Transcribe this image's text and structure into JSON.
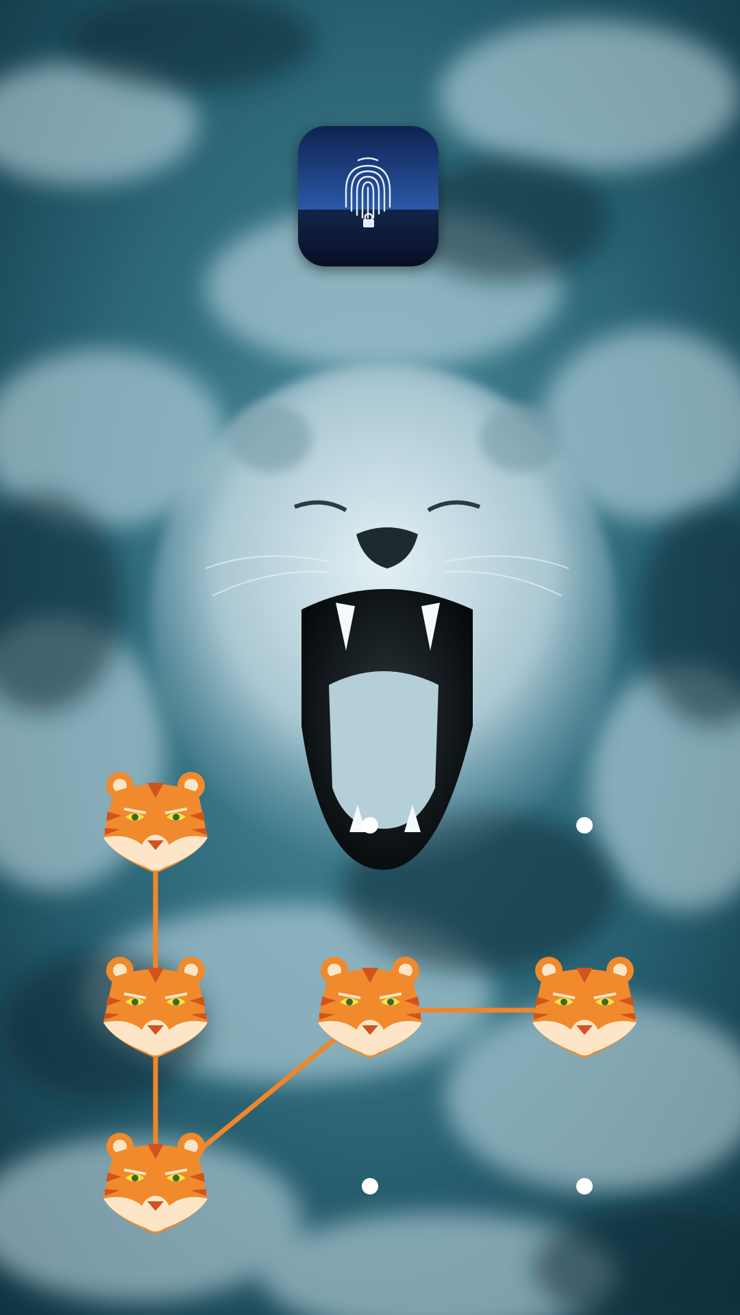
{
  "app": {
    "icon_name": "fingerprint-lock-icon",
    "colors": {
      "icon_top": "#1f3f7a",
      "icon_bottom": "#0d1a36",
      "fingerprint": "#e6eefc"
    }
  },
  "pattern_lock": {
    "node_icon": "tiger-face-icon",
    "dot_color": "#ffffff",
    "line_color": "#f0862a",
    "nodes": [
      {
        "row": 1,
        "col": 1,
        "state": "selected"
      },
      {
        "row": 1,
        "col": 2,
        "state": "idle"
      },
      {
        "row": 1,
        "col": 3,
        "state": "idle"
      },
      {
        "row": 2,
        "col": 1,
        "state": "selected"
      },
      {
        "row": 2,
        "col": 2,
        "state": "selected"
      },
      {
        "row": 2,
        "col": 3,
        "state": "selected"
      },
      {
        "row": 3,
        "col": 1,
        "state": "selected"
      },
      {
        "row": 3,
        "col": 2,
        "state": "idle"
      },
      {
        "row": 3,
        "col": 3,
        "state": "idle"
      }
    ],
    "path_order": [
      {
        "row": 1,
        "col": 1
      },
      {
        "row": 2,
        "col": 1
      },
      {
        "row": 3,
        "col": 1
      },
      {
        "row": 2,
        "col": 2
      },
      {
        "row": 2,
        "col": 3
      }
    ]
  },
  "wallpaper": {
    "subject": "roaring-lion-in-ocean-waves",
    "colors": {
      "water_dark": "#0f3340",
      "water_mid": "#2f6e7e",
      "foam": "#cfe6ee",
      "lion": "#c9dfe8"
    }
  }
}
